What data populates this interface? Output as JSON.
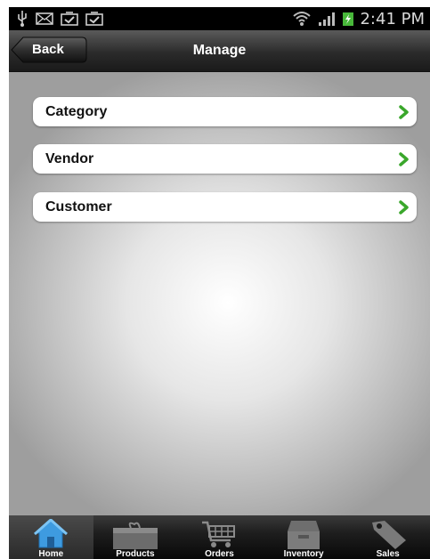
{
  "status_bar": {
    "time": "2:41 PM",
    "left_icons": [
      "usb-icon",
      "mail-icon",
      "task-done-icon",
      "task-done-icon"
    ],
    "right_icons": [
      "wifi-icon",
      "signal-icon",
      "battery-charging-icon"
    ]
  },
  "nav": {
    "back_label": "Back",
    "title": "Manage"
  },
  "menu": {
    "items": [
      {
        "label": "Category"
      },
      {
        "label": "Vendor"
      },
      {
        "label": "Customer"
      }
    ]
  },
  "tabs": [
    {
      "label": "Home",
      "icon": "home-icon",
      "active": true
    },
    {
      "label": "Products",
      "icon": "gift-box-icon",
      "active": false
    },
    {
      "label": "Orders",
      "icon": "cart-icon",
      "active": false
    },
    {
      "label": "Inventory",
      "icon": "cabinet-icon",
      "active": false
    },
    {
      "label": "Sales",
      "icon": "tag-icon",
      "active": false
    }
  ],
  "colors": {
    "accent_chevron": "#3aa72b",
    "home_icon_blue": "#3e9be0"
  }
}
